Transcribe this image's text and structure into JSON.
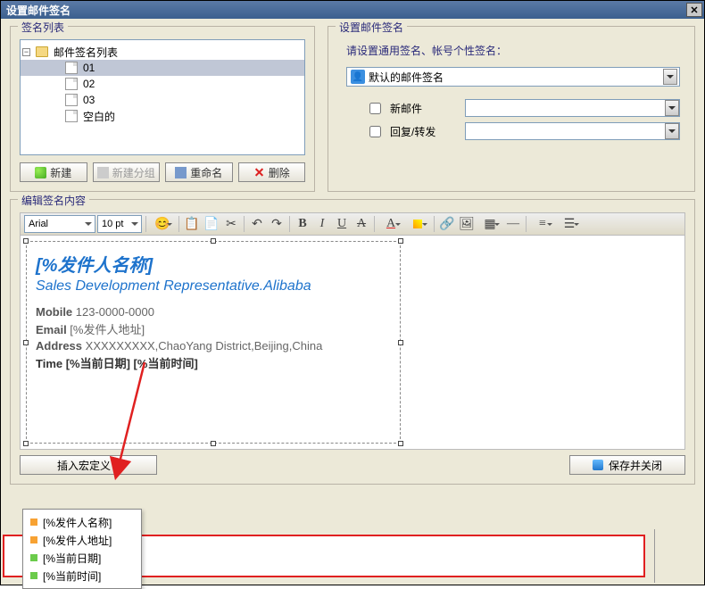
{
  "window": {
    "title": "设置邮件签名"
  },
  "sig_list": {
    "legend": "签名列表",
    "root": "邮件签名列表",
    "items": [
      "01",
      "02",
      "03",
      "空白的"
    ],
    "btn_new": "新建",
    "btn_newgroup": "新建分组",
    "btn_rename": "重命名",
    "btn_delete": "删除"
  },
  "set_sig": {
    "legend": "设置邮件签名",
    "instr": "请设置通用签名、帐号个性签名：",
    "selected": "默认的邮件签名",
    "opt_newmail": "新邮件",
    "opt_reply": "回复/转发"
  },
  "editor": {
    "legend": "编辑签名内容",
    "font": "Arial",
    "size": "10 pt",
    "sig": {
      "name": "[%发件人名称]",
      "title": "Sales Development Representative.Alibaba",
      "mobile_lbl": "Mobile",
      "mobile": " 123-0000-0000",
      "email_lbl": "Email",
      "email": " [%发件人地址]",
      "addr_lbl": "Address",
      "addr": " XXXXXXXXX,ChaoYang District,Beijing,China",
      "time_lbl": "Time",
      "time": " [%当前日期] [%当前时间]"
    }
  },
  "bottom": {
    "macro_btn": "插入宏定义",
    "save_btn": "保存并关闭",
    "macros": [
      "[%发件人名称]",
      "[%发件人地址]",
      "[%当前日期]",
      "[%当前时间]"
    ]
  }
}
